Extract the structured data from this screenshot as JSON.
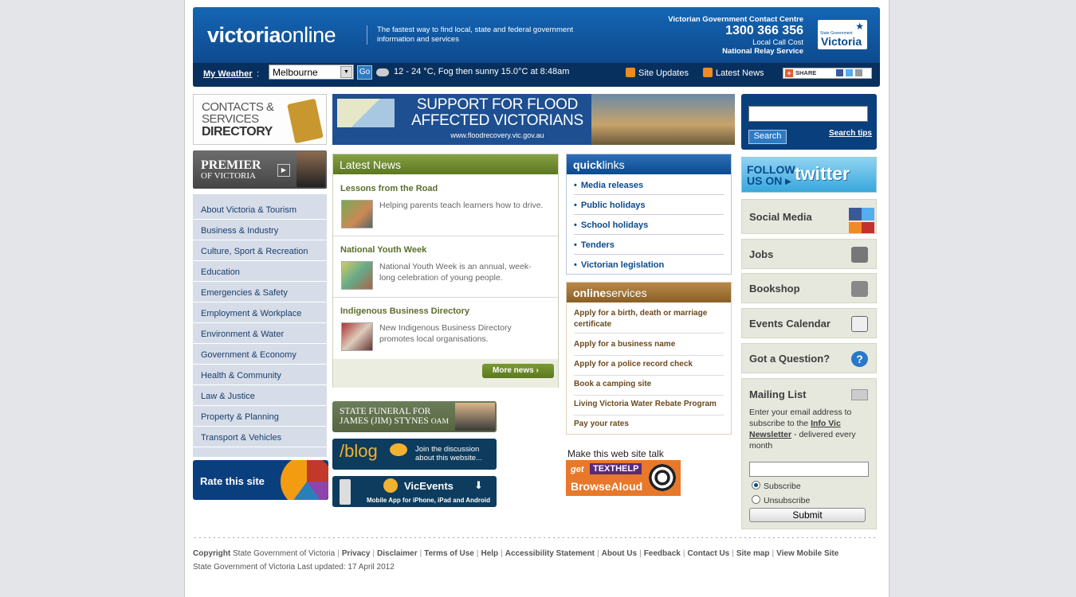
{
  "header": {
    "logo_bold": "victoria",
    "logo_light": "online",
    "tagline": "The fastest way to find local, state and federal government information and services",
    "contact_title": "Victorian Government Contact Centre",
    "contact_phone": "1300 366 356",
    "contact_note": "Local Call Cost",
    "contact_relay": "National Relay Service",
    "vic_logo_small": "State Government",
    "vic_logo_name": "Victoria"
  },
  "weather": {
    "label": "My Weather",
    "colon": ":",
    "city": "Melbourne",
    "go": "Go",
    "text": "12 - 24 °C, Fog then sunny 15.0°C at 8:48am"
  },
  "toplinks": {
    "site_updates": "Site Updates",
    "latest_news": "Latest News",
    "share": "SHARE"
  },
  "left": {
    "contacts_line1": "CONTACTS &",
    "contacts_line2": "SERVICES",
    "contacts_line3": "DIRECTORY",
    "premier_line1": "PREMIER",
    "premier_line2": "OF VICTORIA",
    "nav": [
      "About Victoria & Tourism",
      "Business & Industry",
      "Culture, Sport & Recreation",
      "Education",
      "Emergencies & Safety",
      "Employment & Workplace",
      "Environment & Water",
      "Government & Economy",
      "Health & Community",
      "Law & Justice",
      "Property & Planning",
      "Transport & Vehicles"
    ],
    "rate": "Rate this site"
  },
  "banner": {
    "line1": "SUPPORT FOR FLOOD",
    "line2": "AFFECTED VICTORIANS",
    "url": "www.floodrecovery.vic.gov.au"
  },
  "news": {
    "heading": "Latest News",
    "articles": [
      {
        "title": "Lessons from the Road",
        "desc": "Helping parents teach learners how to drive."
      },
      {
        "title": "National Youth Week",
        "desc": "National Youth Week is an annual, week-long celebration of young people."
      },
      {
        "title": "Indigenous Business Directory",
        "desc": "New Indigenous Business Directory promotes local organisations."
      }
    ],
    "more": "More news"
  },
  "promos": {
    "funeral_1": "STATE FUNERAL FOR",
    "funeral_2": "JAMES (JIM) STYNES",
    "funeral_suffix": "OAM",
    "blog": "/blog",
    "blog_text1": "Join the discussion",
    "blog_text2": "about this website...",
    "vicevents": "VicEvents",
    "vicevents_sub": "Mobile App for iPhone, iPad and Android"
  },
  "quicklinks": {
    "heading_bold": "quick",
    "heading_light": "links",
    "items": [
      "Media releases",
      "Public holidays",
      "School holidays",
      "Tenders",
      "Victorian legislation"
    ]
  },
  "online_services": {
    "heading_bold": "online",
    "heading_light": "services",
    "items": [
      "Apply for a birth, death or marriage certificate",
      "Apply for a business name",
      "Apply for a police record check",
      "Book a camping site",
      "Living Victoria Water Rebate Program",
      "Pay your rates"
    ]
  },
  "browsealoud": {
    "title": "Make this web site talk",
    "get": "get",
    "texthelp": "TEXTHELP",
    "name": "BrowseAloud"
  },
  "search": {
    "button": "Search",
    "tips": "Search tips"
  },
  "twitter": {
    "follow1": "FOLLOW",
    "follow2": "US ON",
    "name": "twitter"
  },
  "boxes": {
    "social": "Social Media",
    "jobs": "Jobs",
    "bookshop": "Bookshop",
    "events": "Events Calendar",
    "question": "Got a Question?"
  },
  "mailing": {
    "title": "Mailing List",
    "desc_before": "Enter your email address to subscribe to the",
    "link": "Info Vic Newsletter",
    "desc_after": "- delivered every month",
    "subscribe": "Subscribe",
    "unsubscribe": "Unsubscribe",
    "submit": "Submit"
  },
  "footer": {
    "copyright_bold": "Copyright",
    "copyright_rest": "State Government of Victoria",
    "links": [
      "Privacy",
      "Disclaimer",
      "Terms of Use",
      "Help",
      "Accessibility Statement",
      "About Us",
      "Feedback",
      "Contact Us",
      "Site map",
      "View Mobile Site"
    ],
    "updated": "State Government of Victoria Last updated: 17 April 2012"
  },
  "colors": {
    "brand_blue": "#0b4a8e",
    "news_green": "#5c7722",
    "services_brown": "#8a5e24",
    "nav_bg": "#d6dde8"
  }
}
